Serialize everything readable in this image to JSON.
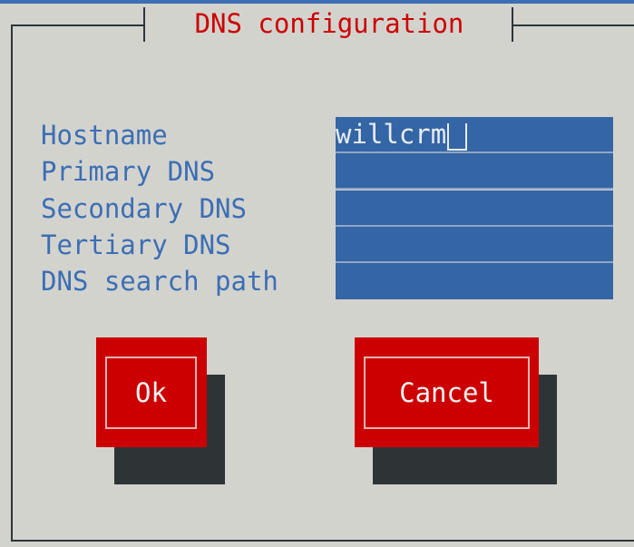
{
  "dialog": {
    "title": " DNS configuration ",
    "colors": {
      "background": "#d3d3ce",
      "title": "#cc0000",
      "label": "#3c6eb4",
      "field": "#3465a4",
      "button": "#cc0000",
      "shadow": "#2e3436"
    }
  },
  "fields": [
    {
      "label": "Hostname",
      "value": "willcrm"
    },
    {
      "label": "Primary DNS",
      "value": ""
    },
    {
      "label": "Secondary DNS",
      "value": ""
    },
    {
      "label": "Tertiary DNS",
      "value": ""
    },
    {
      "label": "DNS search path",
      "value": ""
    }
  ],
  "buttons": {
    "ok_label": "Ok",
    "cancel_label": "Cancel"
  }
}
